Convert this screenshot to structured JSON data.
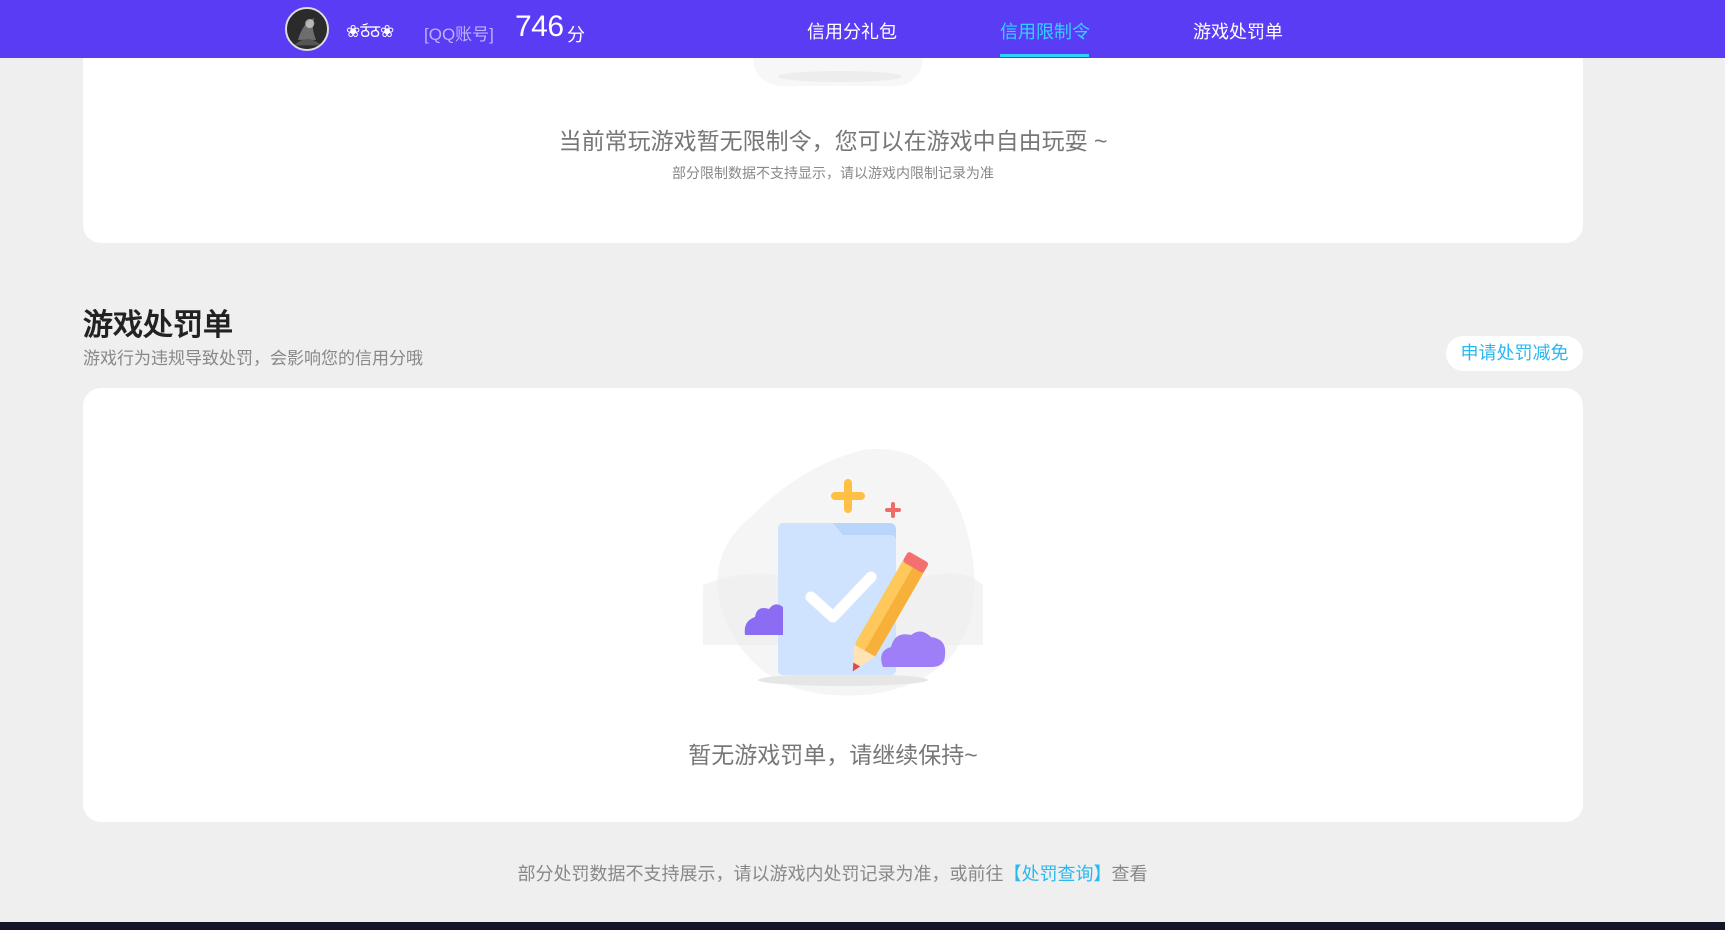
{
  "header": {
    "nickname": "❀ठ᷄ठ❀",
    "account_type": "[QQ账号]",
    "score": "746",
    "score_unit": "分",
    "tabs": [
      {
        "label": "信用分礼包",
        "active": false
      },
      {
        "label": "信用限制令",
        "active": true
      },
      {
        "label": "游戏处罚单",
        "active": false
      }
    ],
    "colors": {
      "bar": "#5b3cf5",
      "active_tab": "#2fd3ff"
    }
  },
  "restriction": {
    "empty_text": "当前常玩游戏暂无限制令，您可以在游戏中自由玩耍 ~",
    "note": "部分限制数据不支持显示，请以游戏内限制记录为准"
  },
  "penalty": {
    "title": "游戏处罚单",
    "subtitle": "游戏行为违规导致处罚，会影响您的信用分哦",
    "appeal_button": "申请处罚减免",
    "empty_text": "暂无游戏罚单，请继续保持~",
    "illustration_icon": "checked-document-pencil-icon"
  },
  "footer": {
    "note_prefix": "部分处罚数据不支持展示，请以游戏内处罚记录为准，或前往",
    "link_text": "【处罚查询】",
    "note_suffix": "查看",
    "link_color": "#2ab8f0"
  }
}
